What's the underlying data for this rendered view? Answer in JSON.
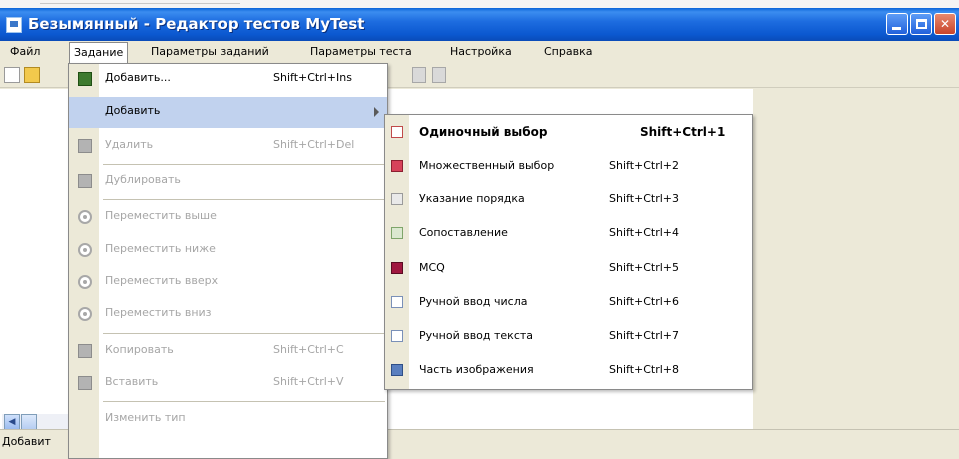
{
  "window": {
    "title": "Безымянный - Редактор тестов MyTest"
  },
  "menubar": {
    "items": [
      {
        "label": "Файл"
      },
      {
        "label": "Задание"
      },
      {
        "label": "Параметры заданий"
      },
      {
        "label": "Параметры теста"
      },
      {
        "label": "Настройка"
      },
      {
        "label": "Справка"
      }
    ],
    "active_item": "Задание"
  },
  "dropdown": {
    "items": [
      {
        "label": "Добавить...",
        "shortcut": "Shift+Ctrl+Ins",
        "enabled": true,
        "icon": "add-task-icon"
      },
      {
        "label": "Добавить",
        "shortcut": "",
        "enabled": true,
        "highlighted": true,
        "has_submenu": true
      },
      {
        "label": "Удалить",
        "shortcut": "Shift+Ctrl+Del",
        "enabled": false,
        "icon": "delete-task-icon"
      },
      {
        "label": "Дублировать",
        "shortcut": "",
        "enabled": false,
        "icon": "duplicate-task-icon"
      },
      {
        "label": "Переместить выше",
        "shortcut": "",
        "enabled": false,
        "icon": "move-up-icon"
      },
      {
        "label": "Переместить ниже",
        "shortcut": "",
        "enabled": false,
        "icon": "move-down-icon"
      },
      {
        "label": "Переместить вверх",
        "shortcut": "",
        "enabled": false,
        "icon": "move-top-icon"
      },
      {
        "label": "Переместить вниз",
        "shortcut": "",
        "enabled": false,
        "icon": "move-bottom-icon"
      },
      {
        "label": "Копировать",
        "shortcut": "Shift+Ctrl+C",
        "enabled": false,
        "icon": "copy-icon"
      },
      {
        "label": "Вставить",
        "shortcut": "Shift+Ctrl+V",
        "enabled": false,
        "icon": "paste-icon"
      },
      {
        "label": "Изменить тип",
        "shortcut": "",
        "enabled": false
      }
    ]
  },
  "submenu": {
    "items": [
      {
        "label": "Одиночный выбор",
        "shortcut": "Shift+Ctrl+1",
        "bold": true,
        "icon": "single-choice-icon"
      },
      {
        "label": "Множественный выбор",
        "shortcut": "Shift+Ctrl+2",
        "icon": "multiple-choice-icon"
      },
      {
        "label": "Указание порядка",
        "shortcut": "Shift+Ctrl+3",
        "icon": "ordering-icon"
      },
      {
        "label": "Сопоставление",
        "shortcut": "Shift+Ctrl+4",
        "icon": "matching-icon"
      },
      {
        "label": "MCQ",
        "shortcut": "Shift+Ctrl+5",
        "icon": "mcq-icon"
      },
      {
        "label": "Ручной ввод числа",
        "shortcut": "Shift+Ctrl+6",
        "icon": "number-input-icon"
      },
      {
        "label": "Ручной ввод текста",
        "shortcut": "Shift+Ctrl+7",
        "icon": "text-input-icon"
      },
      {
        "label": "Часть изображения",
        "shortcut": "Shift+Ctrl+8",
        "icon": "image-part-icon"
      }
    ]
  },
  "statusbar": {
    "text": "Добавит"
  }
}
